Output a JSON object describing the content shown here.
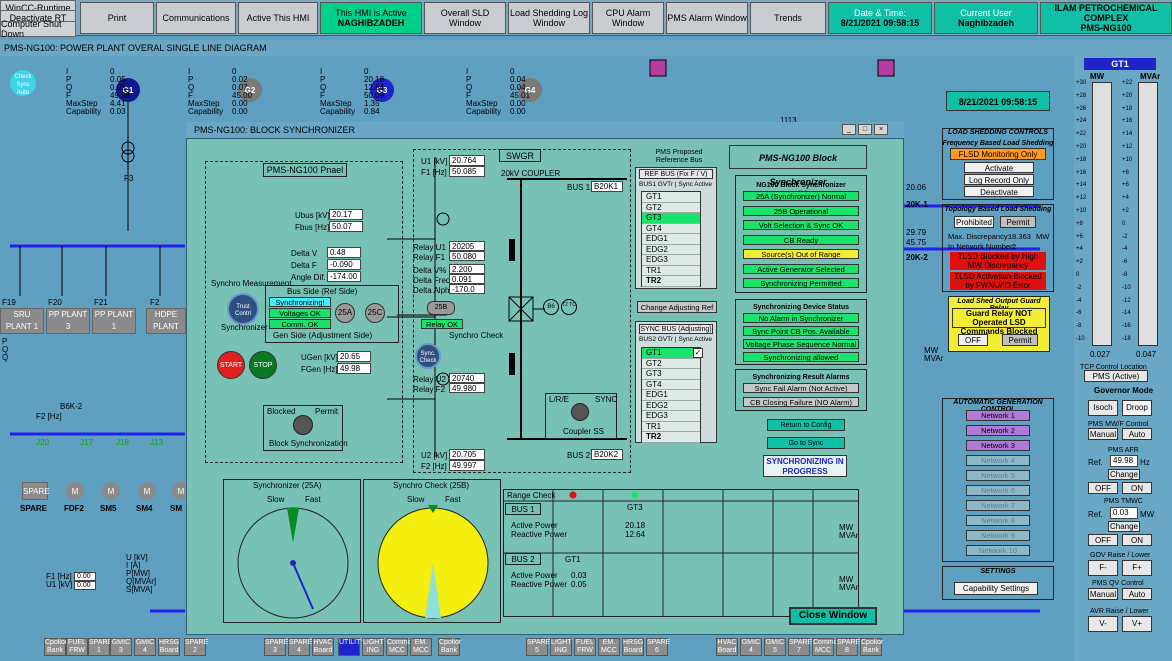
{
  "window": {
    "app_title": "WinCC-Runtime",
    "main_title": "PMS-NG100: POWER PLANT OVERAL SINGLE LINE DIAGRAM"
  },
  "system_buttons": {
    "deactivate_rt": "Deactivate RT",
    "shutdown": "Computer Shut Down"
  },
  "topbar": {
    "print": "Print",
    "communications": "Communications",
    "active_hmi": "Active This HMI",
    "this_hmi_active_label": "This HMI is Active",
    "this_hmi_active_user": "NAGHIBZADEH",
    "overall_sld": "Overall SLD Window",
    "load_shedding_log": "Load Shedding Log Window",
    "cpu_alarm": "CPU Alarm Window",
    "pms_alarm": "PMS Alarm Window",
    "trends": "Trends",
    "datetime_label": "Date & Time:",
    "datetime_value": "8/21/2021 09:58:15",
    "current_user_label": "Current User",
    "current_user_value": "Naghibzadeh",
    "company": "ILAM PETROCHEMICAL COMPLEX",
    "company_sub": "PMS-NG100"
  },
  "main": {
    "gens": [
      {
        "name": "G1",
        "I": "0",
        "P": "0.05",
        "Q": "0.05",
        "F": "49.98",
        "maxstep": "4.41",
        "cap": "0.03"
      },
      {
        "name": "G2",
        "I": "0",
        "P": "0.02",
        "Q": "0.07",
        "F": "45.00",
        "maxstep": "0.00",
        "cap": "0.00"
      },
      {
        "name": "G3",
        "I": "0",
        "P": "20.18",
        "Q": "12.64",
        "F": "50.09",
        "maxstep": "1.35",
        "cap": "0.84"
      },
      {
        "name": "G4",
        "I": "0",
        "P": "0.04",
        "Q": "0.04",
        "F": "45.01",
        "maxstep": "0.00",
        "cap": "0.00"
      }
    ],
    "gen_labels": {
      "i": "I",
      "p": "P",
      "q": "Q",
      "f": "F",
      "maxstep": "MaxStep",
      "cap": "Capability"
    },
    "auto_sync": "Check Sync Auto",
    "sru": "SRU PLANT 1",
    "pp3": "PP PLANT 3",
    "pp1": "PP PLANT 1",
    "hdpe": "HDPE PLANT",
    "f19": "F19",
    "f20": "F20",
    "f21": "F21",
    "f2": "F2",
    "f3": "F3",
    "b6k2": "B6K-2",
    "bus_j20": "J20",
    "bus_j17": "J17",
    "bus_j18": "J18",
    "bus_j13": "J13",
    "feeders": [
      "SPARE",
      "FDF2",
      "SM5",
      "SM4",
      "SM"
    ],
    "f2hz": "F2 [Hz]",
    "f1hz": "F1 [Hz]",
    "u1kv": "U1 [kV]",
    "ui_labels": {
      "u": "U [kV]",
      "i": "I [A]",
      "p": "P[MW]",
      "q": "Q[MVAr]",
      "s": "S[MVA]"
    },
    "val0": "0",
    "val000": "0.00",
    "right_vals": [
      "20.06",
      "20K-1",
      "29.79",
      "45.75",
      "20K-2"
    ],
    "pqo": [
      "P",
      "Q",
      "Q"
    ],
    "lbl_1113": "1113",
    "side_mw": "MW",
    "side_mvar": "MVAr"
  },
  "bottom_buttons": [
    "Cpolior Bank",
    "FUEL FRW",
    "SPARE 1",
    "GMIC 3",
    "GMIC 4",
    "HRSG Board",
    "SPARE 2",
    "SPARE 3",
    "SPARE 4",
    "HVAC Board",
    "UTILITY",
    "LIGHT ING",
    "Common MCC",
    "EM. MCC",
    "Cpolior Bank",
    "SPARE 5",
    "LIGHT ING",
    "FUEL FRW",
    "EM. MCC",
    "HRSG Board",
    "SPARE 6",
    "HVAC Board",
    "GMIC 4",
    "GMIC 5",
    "SPARE 7",
    "Common MCC",
    "SPARE 8",
    "Cpolior Bank"
  ],
  "dialog": {
    "title": "PMS-NG100: BLOCK SYNCHRONIZER",
    "panel_title": "PMS-NG100 Pnael",
    "ubus_label": "Ubus [kV]",
    "ubus": "20.17",
    "fbus_label": "Fbus [Hz]",
    "fbus": "50.07",
    "delta_v_label": "Delta V",
    "delta_v": "0.48",
    "delta_f_label": "Delta F",
    "delta_f": "-0.090",
    "angle_label": "Angle Dif.",
    "angle": "-174.00",
    "synchro_measurement": "Synchro Measurement",
    "synchronizer": "Synchronizer",
    "sync_unit": "Trust Contrl",
    "bus_side": "Bus Side (Ref Side)",
    "synchronizing": "Synchronizing!",
    "voltages_ok": "Voltages OK",
    "comm_ok": "Comm. OK",
    "gen_side": "Gen Side (Adjustment Side)",
    "b25a": "25A",
    "b25c": "25C",
    "start": "START",
    "stop": "STOP",
    "ugen_label": "UGen [kV]",
    "ugen": "20.65",
    "fgen_label": "FGen [Hz]",
    "fgen": "49.98",
    "blocked": "Blocked",
    "permit": "Permit",
    "block_sync": "Block Synchronization",
    "swgr": "SWGR",
    "coupler_20kv": "20kV COUPLER",
    "u1_label": "U1 [kV]",
    "u1": "20.764",
    "f1_label": "F1 [Hz]",
    "f1": "50.085",
    "bus1_label": "BUS 1:",
    "bus1": "B20K1",
    "relay_u1_label": "Relay U1",
    "relay_u1": "20205",
    "relay_f1_label": "Relay F1",
    "relay_f1": "50.080",
    "dvp_label": "Delta V%",
    "dvp": "2.200",
    "dfreq_label": "Delta Freq",
    "dfreq": "0.091",
    "dalpha_label": "Delta Alpha",
    "dalpha": "-170.0",
    "s25b": "25B",
    "relay_ok": "Relay OK",
    "synchro_check": "Synchro Check",
    "sync_check_unit": "Sync. Check",
    "relay_u2_label": "Relay U2",
    "relay_u2": "20740",
    "relay_f2_label": "Relay F2",
    "relay_f2": "49.980",
    "b6": "B6",
    "t2tc": "T2 TC",
    "lre": "L/R/E",
    "sync": "SYNC",
    "coupler_ss": "Coupler SS",
    "u2_label": "U2 [kV]",
    "u2": "20.705",
    "f2_label": "F2 [Hz]",
    "f2": "49.997",
    "bus2_label": "BUS 2:",
    "bus2": "B20K2",
    "proposed_ref": "PMS Proposed Reference Bus",
    "ref_bus": "REF BUS (Fix F / V)",
    "bus1_gvtr": "BUS1 GVTr | Sync Active",
    "list1": [
      "GT1",
      "GT2",
      "GT3",
      "GT4",
      "EDG1",
      "EDG2",
      "EDG3",
      "TR1",
      "TR2"
    ],
    "change_ref": "Change Adjusting Ref",
    "sync_bus": "SYNC BUS (Adjusting)",
    "bus2_gvtr": "BUS2 GVTr | Sync Active",
    "list2": [
      "GT1",
      "GT2",
      "GT3",
      "GT4",
      "EDG1",
      "EDG2",
      "EDG3",
      "TR1",
      "TR2"
    ],
    "check_mark": "✓",
    "block_title": "PMS-NG100 Block Synchronizer",
    "conditions_title": "NG100 Block Synchronizer Conditions",
    "conditions": [
      "25A (Synchronizer) Normal",
      "25B Operational",
      "Volt Selection & Sync OK",
      "CB Ready",
      "Source(s) Out of Range",
      "Active Generator Selected",
      "Synchronizing Permitted"
    ],
    "device_title": "Synchronizing Device Status",
    "device": [
      "No Alarm in Synchronizer",
      "Sync Point CB Pos. Available",
      "Voltage Phase Sequence Normal",
      "Synchronizing allowed"
    ],
    "result_title": "Synchronizing Result Alarms",
    "results": [
      "Sync Fail Alarm (Not Active)",
      "CB Closing Failure (NO Alarm)"
    ],
    "return_config": "Return to Config",
    "go_sync": "Go to Sync",
    "sync_progress": "SYNCHRONIZING IN PROGRESS",
    "synch_25a": "Synchronizer (25A)",
    "check_25b": "Synchro Check (25B)",
    "slow": "Slow",
    "fast": "Fast",
    "range_check": "Range Check",
    "r_bus1": "BUS 1",
    "r_gt3": "GT3",
    "active_power": "Active Power",
    "reactive_power": "Reactive Power",
    "b1_p": "20.18",
    "b1_q": "12.64",
    "mw": "MW",
    "mvar": "MVAr",
    "r_bus2": "BUS 2",
    "r_gt1": "GT1",
    "b2_p": "0.03",
    "b2_q": "0.05",
    "close": "Close Window"
  },
  "right_panel": {
    "datetime": "8/21/2021 09:58:15",
    "ls_title": "LOAD SHEDDING CONTROLS",
    "freq_based": "Frequency Based Load Shedding",
    "flsd_monitoring": "FLSD Monitoring Only",
    "activate": "Activate",
    "log_record": "Log Record Only",
    "deactivate": "Deactivate",
    "topology_based": "Topology Based Load Shedding",
    "prohibited": "Prohibited",
    "permit": "Permit",
    "max_disc_label": "Max. Discrepancy:",
    "max_disc": "18.363",
    "mw": "MW",
    "in_network_label": "In Network Number:",
    "in_network": "2",
    "tlsd_blocked": "TLSD Blocked by High MW Discrepancy",
    "tlsd_activation": "TLSD Activation Blocked by FWNU/IO Error",
    "guard_title": "Load Shed Output Guard Relay",
    "guard_text": "Guard Relay NOT Operated LSD Commands Blocked",
    "off": "OFF",
    "permit2": "Permit",
    "agc_title": "AUTOMATIC GENERATION CONTROL",
    "networks": [
      "Network 1",
      "Network 2",
      "Network 3",
      "Network 4",
      "Network 5",
      "Network 6",
      "Network 7",
      "Network 8",
      "Network 9",
      "Network 10"
    ],
    "settings_title": "SETTINGS",
    "capability": "Capability Settings"
  },
  "far_right": {
    "gt": "GT1",
    "mw": "MW",
    "mvar": "MVAr",
    "scale_mw": [
      "+30",
      "+28",
      "+26",
      "+24",
      "+22",
      "+20",
      "+18",
      "+16",
      "+14",
      "+12",
      "+10",
      "+8",
      "+6",
      "+4",
      "+2",
      "0",
      "-2",
      "-4",
      "-6",
      "-8",
      "-10"
    ],
    "scale_mvar": [
      "+22",
      "+20",
      "+18",
      "+16",
      "+14",
      "+12",
      "+10",
      "+8",
      "+6",
      "+4",
      "+2",
      "0",
      "-2",
      "-4",
      "-6",
      "-8",
      "-10",
      "-12",
      "-14",
      "-16",
      "-18"
    ],
    "mw_val": "0.027",
    "mvar_val": "0.047",
    "tcp_location": "TCP Control Location",
    "pms_active": "PMS (Active)",
    "governor": "Governor Mode",
    "isoch": "Isoch",
    "droop": "Droop",
    "pms_mwf": "PMS MW/F Control",
    "manual": "Manual",
    "auto": "Auto",
    "pms_afr": "PMS AFR",
    "ref": "Ref.",
    "afr_val": "49.98",
    "hz": "Hz",
    "change": "Change",
    "off": "OFF",
    "on": "ON",
    "pms_tmwc": "PMS TMWC",
    "tmwc_val": "0.03",
    "mw2": "MW",
    "gov_raise": "GOV Raise / Lower",
    "fminus": "F-",
    "fplus": "F+",
    "pms_qv": "PMS QV Control",
    "avr": "AVR Raise / Lower",
    "vminus": "V-",
    "vplus": "V+"
  },
  "colors": {
    "background": "#5f9fc0",
    "dialog": "#78c2b5",
    "active_green": "#19e36c",
    "alarm_red": "#e01010"
  }
}
